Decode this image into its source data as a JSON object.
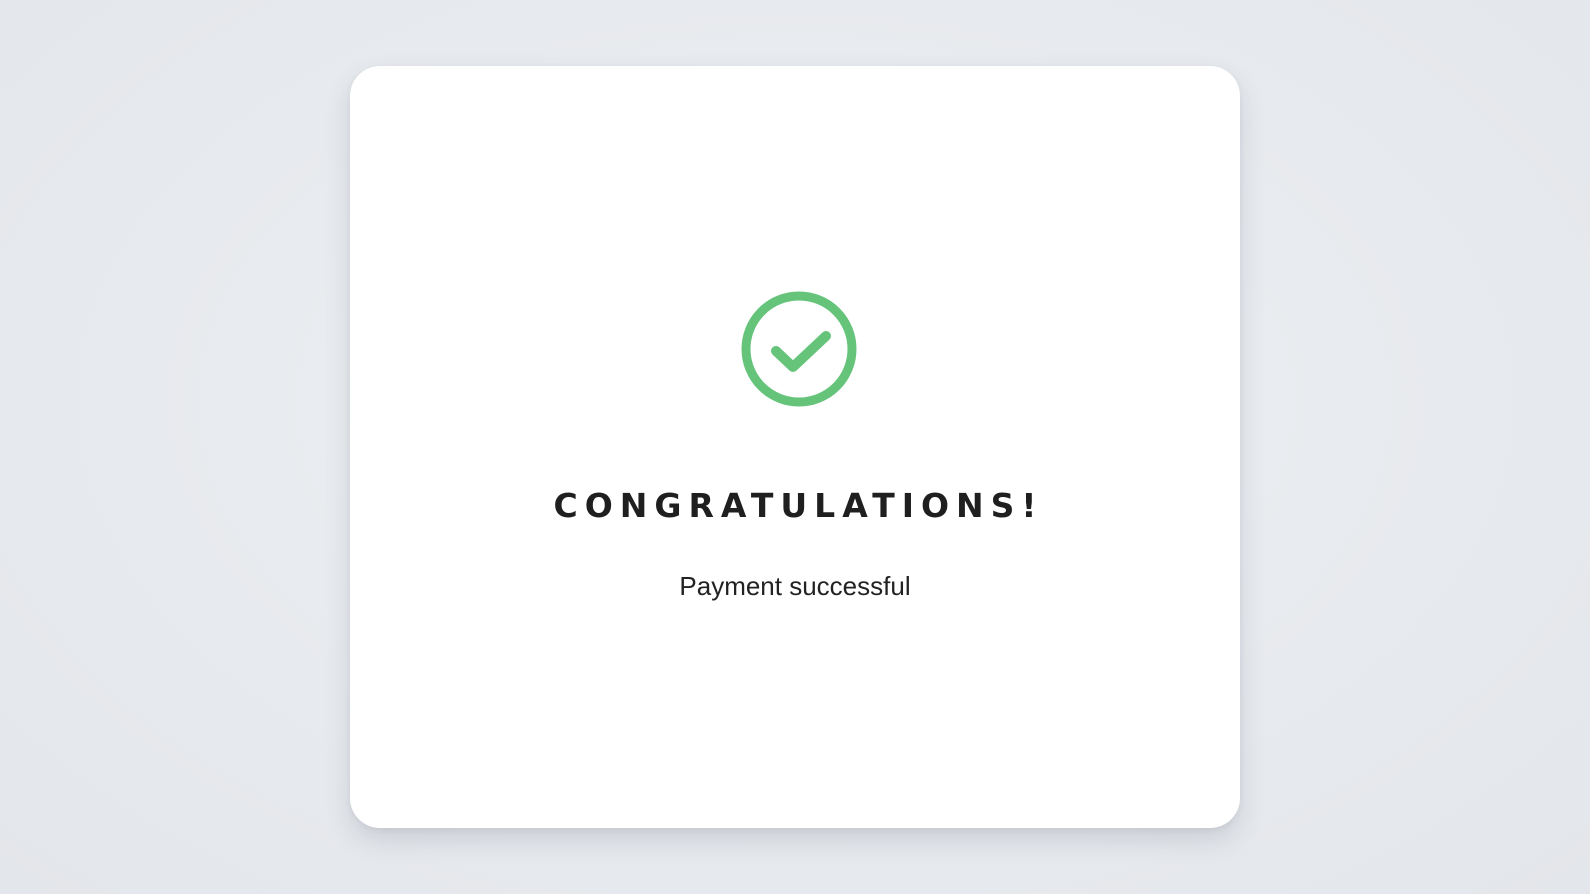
{
  "dialog": {
    "icon": "check-circle-icon",
    "title": "CONGRATULATIONS!",
    "message": "Payment successful"
  },
  "colors": {
    "success": "#66c47a",
    "background": "#e9ecef",
    "card": "#ffffff",
    "text": "#1f1f1f"
  }
}
